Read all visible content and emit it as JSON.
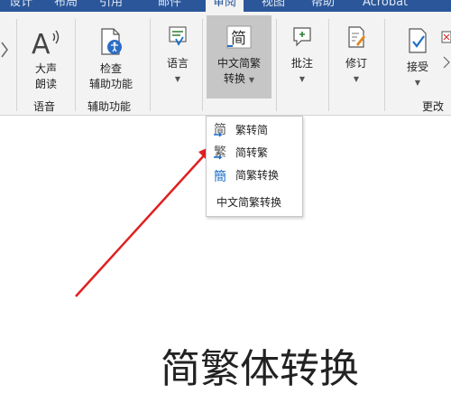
{
  "tabs": [
    "设计",
    "布局",
    "引用",
    "邮件",
    "审阅",
    "视图",
    "帮助",
    "Acrobat"
  ],
  "ribbon": {
    "read_aloud": {
      "line1": "大声",
      "line2": "朗读",
      "group": "语音"
    },
    "accessibility": {
      "line1": "检查",
      "line2": "辅助功能",
      "group": "辅助功能"
    },
    "language": {
      "label": "语言"
    },
    "chinese_conversion": {
      "line1": "中文简繁",
      "line2": "转换"
    },
    "comments": {
      "label": "批注"
    },
    "tracking": {
      "label": "修订"
    },
    "accept": {
      "label": "接受"
    },
    "changes_group": "更改"
  },
  "dropdown": {
    "items": [
      {
        "label": "繁转简",
        "icon": "traditional-to-simplified-icon"
      },
      {
        "label": "简转繁",
        "icon": "simplified-to-traditional-icon"
      },
      {
        "label": "简繁转换",
        "icon": "simplified-traditional-conversion-icon"
      },
      {
        "label": "中文简繁转换"
      }
    ]
  },
  "document": {
    "heading": "简繁体转换"
  },
  "colors": {
    "ribbon_blue": "#2b579a",
    "arrow": "#e02020",
    "icon_blue": "#1e6fc8",
    "highlight": "#c6c6c6"
  }
}
